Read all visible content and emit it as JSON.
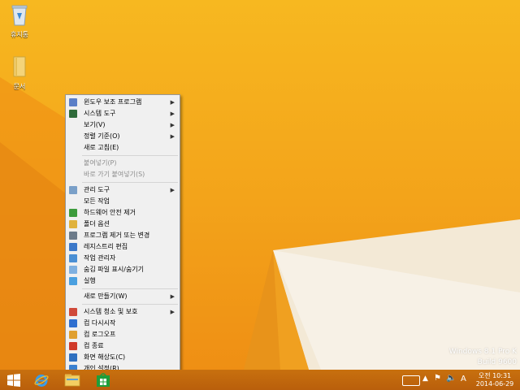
{
  "desktop": {
    "icons": [
      {
        "label": "휴지통",
        "icon": "recycle-bin-icon"
      },
      {
        "label": "문서",
        "icon": "folder-icon"
      }
    ],
    "watermark": {
      "line1": "Windows 8.1 Pro K",
      "line2": "Build 9600"
    }
  },
  "context_menu": {
    "items": [
      {
        "label": "윈도우 보조 프로그램",
        "submenu": true,
        "icon": "accessories-icon"
      },
      {
        "label": "시스템 도구",
        "submenu": true,
        "icon": "system-tools-icon"
      },
      {
        "label": "보기(V)",
        "submenu": true
      },
      {
        "label": "정렬 기준(O)",
        "submenu": true
      },
      {
        "label": "새로 고침(E)"
      },
      {
        "separator": true
      },
      {
        "label": "붙여넣기(P)",
        "disabled": true
      },
      {
        "label": "바로 가기 붙여넣기(S)",
        "disabled": true
      },
      {
        "separator": true
      },
      {
        "label": "관리 도구",
        "submenu": true,
        "icon": "admin-tools-icon"
      },
      {
        "label": "모든 작업"
      },
      {
        "label": "하드웨어 안전 제거",
        "icon": "safe-remove-icon"
      },
      {
        "label": "폴더 옵션",
        "icon": "folder-options-icon"
      },
      {
        "label": "프로그램 제거 또는 변경",
        "icon": "programs-icon"
      },
      {
        "label": "레지스트리 편집",
        "icon": "registry-icon"
      },
      {
        "label": "작업 관리자",
        "icon": "task-manager-icon"
      },
      {
        "label": "숨김 파일 표시/숨기기",
        "icon": "hidden-files-icon"
      },
      {
        "label": "실행",
        "icon": "run-icon"
      },
      {
        "separator": true
      },
      {
        "label": "새로 만들기(W)",
        "submenu": true
      },
      {
        "separator": true
      },
      {
        "label": "시스템 청소 및 보호",
        "submenu": true,
        "icon": "shield-icon"
      },
      {
        "label": "컴 다시시작",
        "icon": "restart-icon"
      },
      {
        "label": "컴 로그오프",
        "icon": "logoff-icon"
      },
      {
        "label": "컴 종료",
        "icon": "power-icon"
      },
      {
        "label": "화면 해상도(C)",
        "icon": "display-icon"
      },
      {
        "label": "개인 설정(R)",
        "icon": "personalize-icon"
      }
    ]
  },
  "taskbar": {
    "ime": "A",
    "time": "오전 10:31",
    "date": "2014-06-29"
  }
}
